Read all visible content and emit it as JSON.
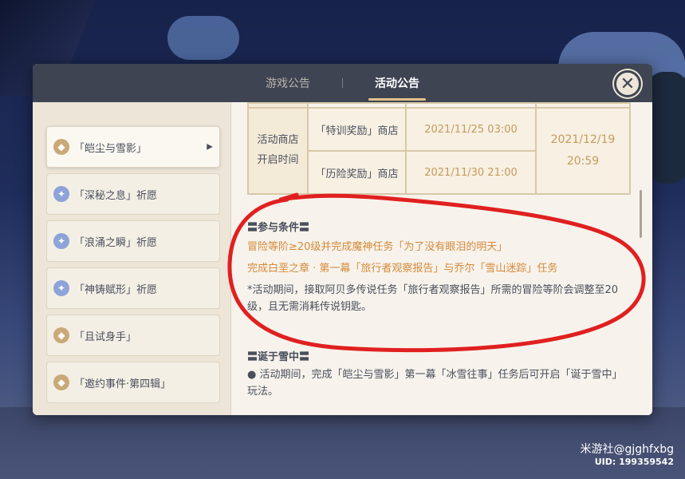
{
  "tabs": [
    {
      "label": "游戏公告"
    },
    {
      "label": "活动公告"
    }
  ],
  "close_label": "✕",
  "sidebar": {
    "items": [
      {
        "label": "「皑尘与雪影」",
        "icon": "diamond-icon",
        "color": "#c9a977"
      },
      {
        "label": "「深秘之息」祈愿",
        "icon": "star-icon",
        "color": "#8ea4d8"
      },
      {
        "label": "「浪涌之瞬」祈愿",
        "icon": "star-icon",
        "color": "#8ea4d8"
      },
      {
        "label": "「神铸赋形」祈愿",
        "icon": "star-icon",
        "color": "#8ea4d8"
      },
      {
        "label": "「且试身手」",
        "icon": "diamond-icon",
        "color": "#c9a977"
      },
      {
        "label": "「邀约事件·第四辑」",
        "icon": "diamond-icon",
        "color": "#c9a977"
      }
    ]
  },
  "shop_table": {
    "label_line1": "活动商店",
    "label_line2": "开启时间",
    "rows": [
      {
        "shop": "「特训奖励」商店",
        "time": "2021/11/25 03:00"
      },
      {
        "shop": "「历险奖励」商店",
        "time": "2021/11/30 21:00"
      }
    ],
    "end_date": "2021/12/19",
    "end_time": "20:59"
  },
  "participation": {
    "title": "〓参与条件〓",
    "req1": "冒险等阶≥20级并完成魔神任务「为了没有眼泪的明天」",
    "req2": "完成白垩之章 · 第一幕「旅行者观察报告」与乔尔「雪山迷踪」任务",
    "note": "*活动期间，接取阿贝多传说任务「旅行者观察报告」所需的冒险等阶会调整至20级，且无需消耗传说钥匙。"
  },
  "born_in_snow": {
    "title": "〓诞于雪中〓",
    "text": "● 活动期间，完成「皑尘与雪影」第一幕「冰雪往事」任务后可开启「诞于雪中」玩法。"
  },
  "watermark": {
    "handle": "米游社@gjghfxbg",
    "uid": "UID: 199359542"
  },
  "colors": {
    "accent_gold": "#c59b5b",
    "accent_orange": "#d68a3a",
    "header": "#3e4452",
    "annotation_red": "#e02020"
  }
}
